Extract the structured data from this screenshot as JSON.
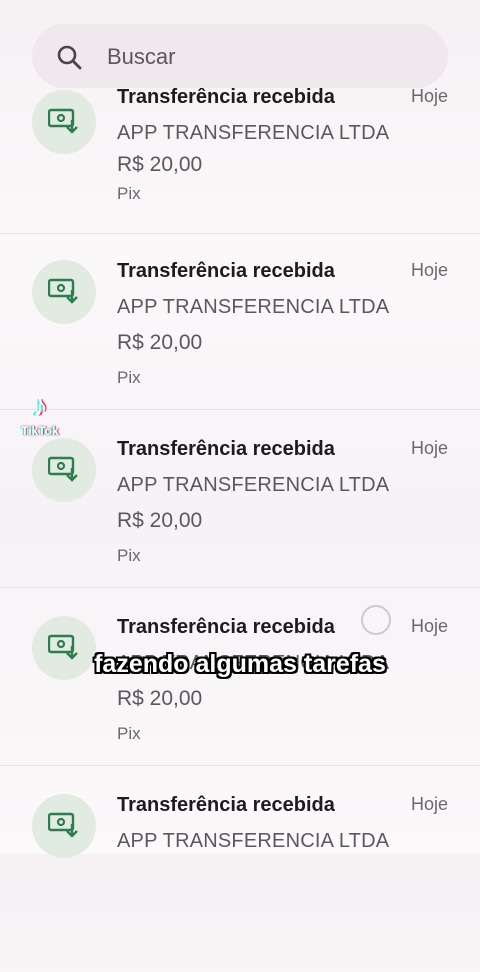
{
  "search": {
    "placeholder": "Buscar",
    "icon": "search-icon"
  },
  "transactions": [
    {
      "title": "Transferência recebida",
      "date": "Hoje",
      "payer": "APP TRANSFERENCIA LTDA",
      "amount": "R$ 20,00",
      "method": "Pix"
    },
    {
      "title": "Transferência recebida",
      "date": "Hoje",
      "payer": "APP TRANSFERENCIA LTDA",
      "amount": "R$ 20,00",
      "method": "Pix"
    },
    {
      "title": "Transferência recebida",
      "date": "Hoje",
      "payer": "APP TRANSFERENCIA LTDA",
      "amount": "R$ 20,00",
      "method": "Pix"
    },
    {
      "title": "Transferência recebida",
      "date": "Hoje",
      "payer": "APP TRANSFERENCIA LTDA",
      "amount": "R$ 20,00",
      "method": "Pix"
    },
    {
      "title": "Transferência recebida",
      "date": "Hoje",
      "payer": "APP TRANSFERENCIA LTDA",
      "amount": "",
      "method": ""
    }
  ],
  "overlay": {
    "caption": "fazendo algumas tarefas",
    "watermark": "TikTok"
  },
  "colors": {
    "icon_bg": "#e2ebe1",
    "icon_fg": "#2e7d4f",
    "background": "#f8f4f7"
  }
}
